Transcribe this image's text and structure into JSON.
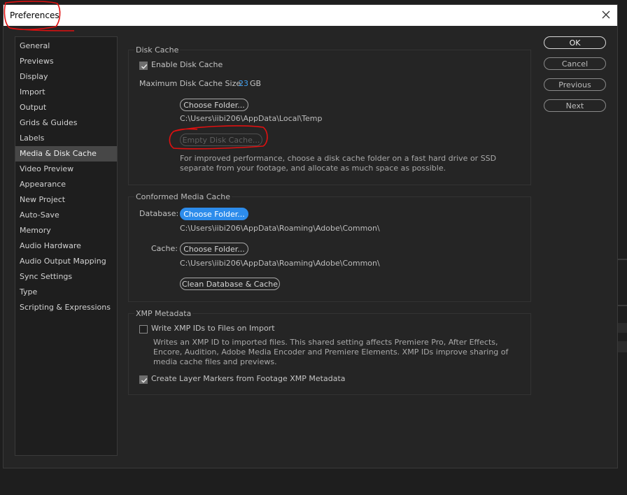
{
  "window": {
    "title": "Preferences"
  },
  "sidebar": {
    "items": [
      {
        "label": "General"
      },
      {
        "label": "Previews"
      },
      {
        "label": "Display"
      },
      {
        "label": "Import"
      },
      {
        "label": "Output"
      },
      {
        "label": "Grids & Guides"
      },
      {
        "label": "Labels"
      },
      {
        "label": "Media & Disk Cache",
        "selected": true
      },
      {
        "label": "Video Preview"
      },
      {
        "label": "Appearance"
      },
      {
        "label": "New Project"
      },
      {
        "label": "Auto-Save"
      },
      {
        "label": "Memory"
      },
      {
        "label": "Audio Hardware"
      },
      {
        "label": "Audio Output Mapping"
      },
      {
        "label": "Sync Settings"
      },
      {
        "label": "Type"
      },
      {
        "label": "Scripting & Expressions"
      }
    ]
  },
  "disk_cache": {
    "legend": "Disk Cache",
    "enable_label": "Enable Disk Cache",
    "enable_checked": true,
    "max_size_label": "Maximum Disk Cache Size:",
    "max_size_value": "23",
    "max_size_unit": "GB",
    "choose_folder": "Choose Folder...",
    "path": "C:\\Users\\iibi206\\AppData\\Local\\Temp",
    "empty_cache": "Empty Disk Cache...",
    "note": "For improved performance, choose a disk cache folder on a fast hard drive or SSD separate from your footage, and allocate as much space as possible."
  },
  "conformed_cache": {
    "legend": "Conformed Media Cache",
    "database_label": "Database:",
    "database_button": "Choose Folder...",
    "database_path": "C:\\Users\\iibi206\\AppData\\Roaming\\Adobe\\Common\\",
    "cache_label": "Cache:",
    "cache_button": "Choose Folder...",
    "cache_path": "C:\\Users\\iibi206\\AppData\\Roaming\\Adobe\\Common\\",
    "clean_button": "Clean Database & Cache"
  },
  "xmp": {
    "legend": "XMP Metadata",
    "write_ids_label": "Write XMP IDs to Files on Import",
    "write_ids_checked": false,
    "write_ids_note": "Writes an XMP ID to imported files. This shared setting affects Premiere Pro, After Effects, Encore, Audition, Adobe Media Encoder and Premiere Elements. XMP IDs improve sharing of media cache files and previews.",
    "layer_markers_label": "Create Layer Markers from Footage XMP Metadata",
    "layer_markers_checked": true
  },
  "actions": {
    "ok": "OK",
    "cancel": "Cancel",
    "previous": "Previous",
    "next": "Next"
  },
  "colors": {
    "accent": "#2d8ceb",
    "annotation": "#e01010"
  }
}
